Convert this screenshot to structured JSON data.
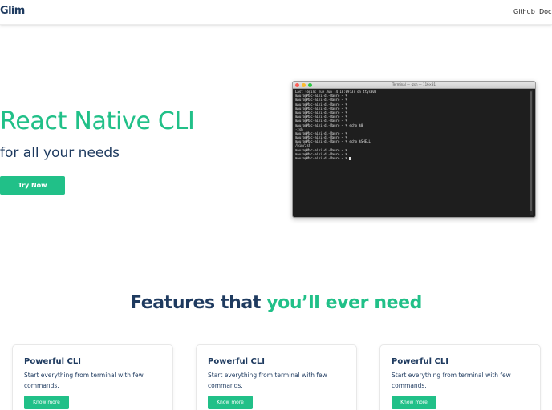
{
  "brand": {
    "logo": "Glim"
  },
  "nav": {
    "links": [
      "Github",
      "Docs"
    ]
  },
  "hero": {
    "title": "React Native CLI",
    "subtitle": "for all your needs",
    "cta": "Try Now"
  },
  "terminal": {
    "title": "Terminal — -zsh — 116×31",
    "lines": [
      "Last login: Tue Jun  4 18:09:37 on ttys000",
      "mauro@Mac-mini-di-Mauro ~ %",
      "mauro@Mac-mini-di-Mauro ~ %",
      "mauro@Mac-mini-di-Mauro ~ %",
      "mauro@Mac-mini-di-Mauro ~ %",
      "mauro@Mac-mini-di-Mauro ~ %",
      "mauro@Mac-mini-di-Mauro ~ %",
      "mauro@Mac-mini-di-Mauro ~ %",
      "mauro@Mac-mini-di-Mauro ~ % echo $0",
      "-zsh",
      "mauro@Mac-mini-di-Mauro ~ %",
      "mauro@Mac-mini-di-Mauro ~ %",
      "mauro@Mac-mini-di-Mauro ~ % echo $SHELL",
      "/bin/zsh",
      "mauro@Mac-mini-di-Mauro ~ %",
      "mauro@Mac-mini-di-Mauro ~ %",
      "mauro@Mac-mini-di-Mauro ~ %"
    ]
  },
  "features": {
    "heading_part1": "Features that ",
    "heading_part2": "you’ll ever need",
    "cards": [
      {
        "title": "Powerful CLI",
        "description": "Start everything from terminal with few commands.",
        "button": "Know more"
      },
      {
        "title": "Powerful CLI",
        "description": "Start everything from terminal with few commands.",
        "button": "Know more"
      },
      {
        "title": "Powerful CLI",
        "description": "Start everything from terminal with few commands.",
        "button": "Know more"
      }
    ]
  },
  "colors": {
    "brand_green": "#21c088",
    "navy": "#1e3a5f",
    "terminal_bg": "#1e1e1e"
  }
}
